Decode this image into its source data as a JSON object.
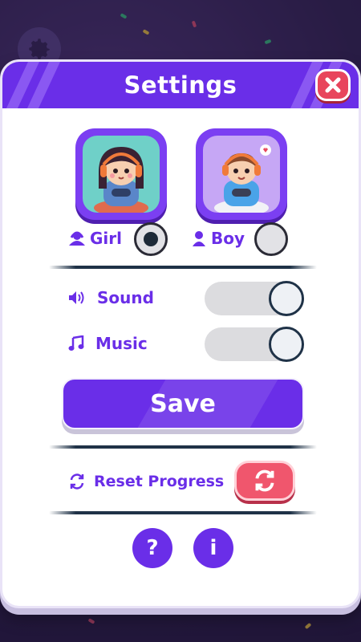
{
  "modal": {
    "title": "Settings",
    "close_icon": "close-icon"
  },
  "avatars": {
    "girl": {
      "label": "Girl",
      "icon": "girl-icon",
      "selected": true
    },
    "boy": {
      "label": "Boy",
      "icon": "boy-icon",
      "selected": false
    }
  },
  "settings": {
    "sound": {
      "label": "Sound",
      "icon": "speaker-icon",
      "on": true
    },
    "music": {
      "label": "Music",
      "icon": "music-note-icon",
      "on": true
    }
  },
  "save": {
    "label": "Save"
  },
  "reset": {
    "label": "Reset Progress",
    "icon": "refresh-icon"
  },
  "footer": {
    "help_label": "?",
    "info_label": "i"
  },
  "colors": {
    "accent": "#6a2ee8",
    "close": "#e8455c",
    "reset": "#f0566d",
    "divider": "#1f3247"
  }
}
